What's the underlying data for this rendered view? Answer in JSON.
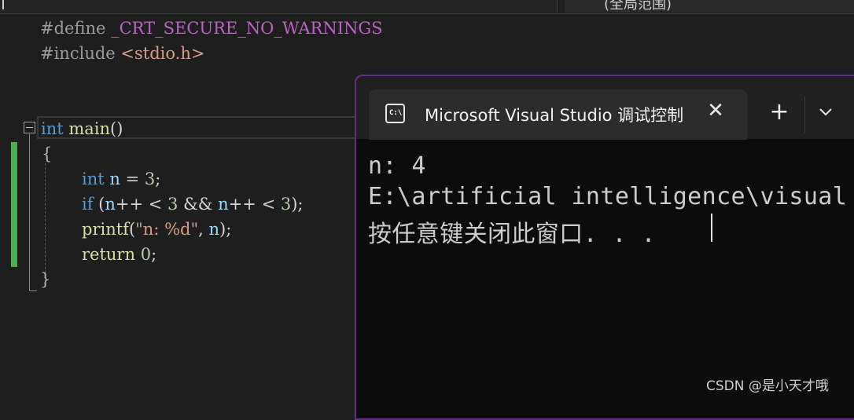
{
  "topbar": {
    "right_label": "(全局范围)"
  },
  "editor": {
    "line1": {
      "directive": "#define",
      "macro": " _CRT_SECURE_NO_WARNINGS"
    },
    "line2": {
      "directive": "#include",
      "header": " <stdio.h>"
    },
    "main_kw": "int",
    "main_name": " main",
    "main_parens": "()",
    "open_brace": "{",
    "decl_kw": "int",
    "decl_var": " n",
    "decl_eq": " = ",
    "decl_num": "3",
    "decl_semi": ";",
    "if_kw": "if",
    "if_open": " (",
    "if_n1": "n",
    "if_mid1": "++ < ",
    "if_num1": "3",
    "if_and": " && ",
    "if_n2": "n",
    "if_mid2": "++ < ",
    "if_num2": "3",
    "if_close": ");",
    "printf_fn": "printf",
    "printf_open": "(",
    "printf_str": "\"n: %d\"",
    "printf_comma": ", ",
    "printf_var": "n",
    "printf_close": ");",
    "return_kw": "return",
    "return_sp": " ",
    "return_num": "0",
    "return_semi": ";",
    "close_brace": "}"
  },
  "console": {
    "tab_icon_text": "C:\\",
    "tab_title": "Microsoft Visual Studio 调试控制台",
    "close_glyph": "✕",
    "new_tab_glyph": "+",
    "output": [
      "n: 4",
      "E:\\artificial intelligence\\visual",
      "按任意键关闭此窗口. . ."
    ]
  },
  "watermark": "CSDN @是小天才哦",
  "colors": {
    "editor_bg": "#1e1e1e",
    "terminal_bg": "#0c0c0c",
    "terminal_border": "#6b2a8f",
    "change_bar": "#4caf50",
    "keyword": "#569cd6",
    "function": "#dcdcaa",
    "string": "#d69d85",
    "number": "#b5cea8"
  }
}
